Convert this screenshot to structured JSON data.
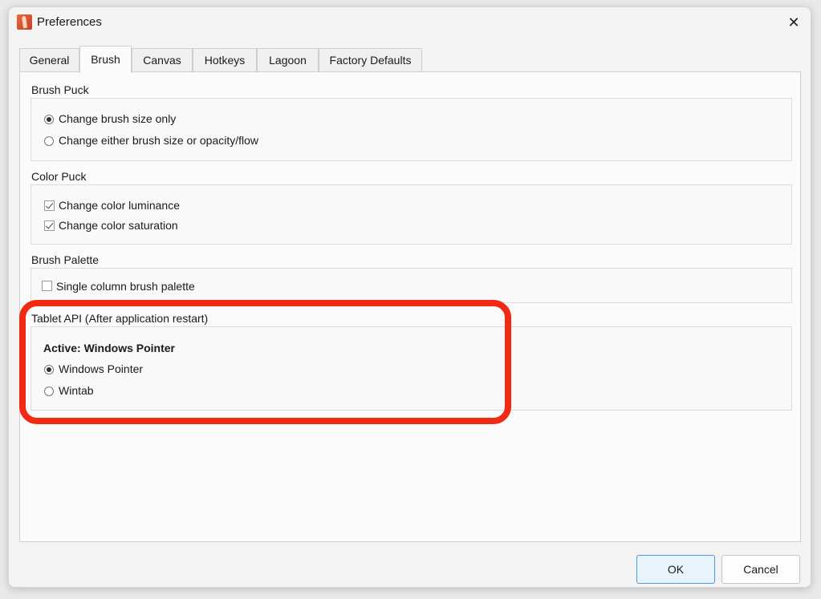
{
  "window": {
    "title": "Preferences"
  },
  "tabs": [
    {
      "label": "General"
    },
    {
      "label": "Brush"
    },
    {
      "label": "Canvas"
    },
    {
      "label": "Hotkeys"
    },
    {
      "label": "Lagoon"
    },
    {
      "label": "Factory Defaults"
    }
  ],
  "active_tab": "Brush",
  "brush_puck": {
    "label": "Brush Puck",
    "options": [
      {
        "label": "Change brush size only",
        "selected": true
      },
      {
        "label": "Change either brush size or opacity/flow",
        "selected": false
      }
    ]
  },
  "color_puck": {
    "label": "Color Puck",
    "options": [
      {
        "label": "Change color luminance",
        "checked": true
      },
      {
        "label": "Change color saturation",
        "checked": true
      }
    ]
  },
  "brush_palette": {
    "label": "Brush Palette",
    "options": [
      {
        "label": "Single column brush palette",
        "checked": false
      }
    ]
  },
  "tablet_api": {
    "label": "Tablet API (After application restart)",
    "active_text": "Active: Windows Pointer",
    "options": [
      {
        "label": "Windows Pointer",
        "selected": true
      },
      {
        "label": "Wintab",
        "selected": false
      }
    ]
  },
  "buttons": {
    "ok": "OK",
    "cancel": "Cancel"
  },
  "colors": {
    "highlight": "#f22a14",
    "default_button": "#4a9be3"
  },
  "icons": {
    "app": "sketchbook-app-icon",
    "close": "close-icon"
  }
}
